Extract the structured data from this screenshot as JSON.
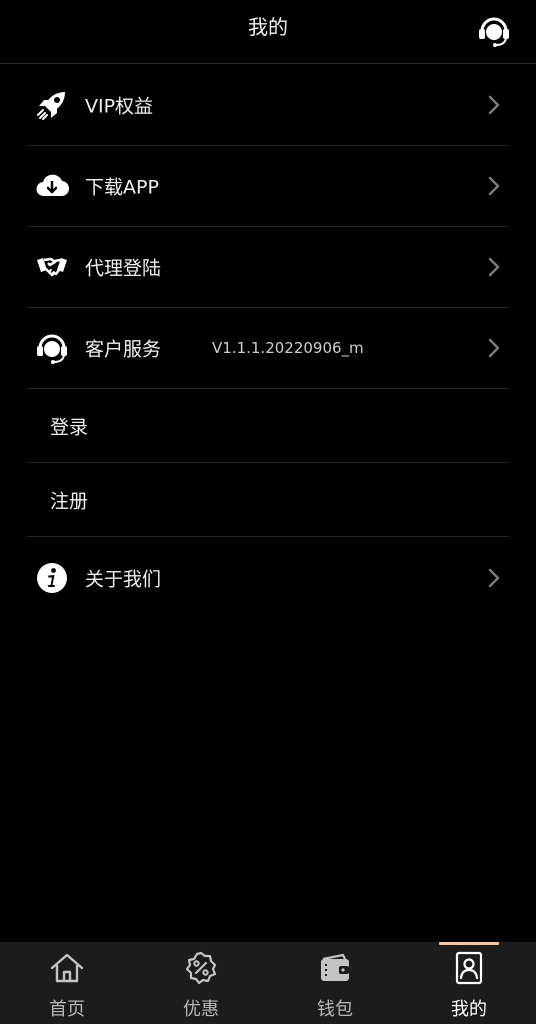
{
  "header": {
    "title": "我的",
    "support_icon": "customer-service-headset-icon"
  },
  "menu": {
    "items": [
      {
        "label": "VIP权益",
        "icon": "rocket-icon"
      },
      {
        "label": "下载APP",
        "icon": "cloud-download-icon"
      },
      {
        "label": "代理登陆",
        "icon": "handshake-icon"
      },
      {
        "label": "客户服务",
        "icon": "headset-icon",
        "version": "V1.1.1.20220906_m"
      },
      {
        "label": "登录"
      },
      {
        "label": "注册"
      },
      {
        "label": "关于我们",
        "icon": "info-icon"
      }
    ]
  },
  "tabbar": {
    "active_index": 3,
    "accent_color": "#f2c9a6",
    "items": [
      {
        "label": "首页",
        "icon": "home-icon"
      },
      {
        "label": "优惠",
        "icon": "discount-badge-icon"
      },
      {
        "label": "钱包",
        "icon": "wallet-icon"
      },
      {
        "label": "我的",
        "icon": "profile-card-icon"
      }
    ]
  }
}
